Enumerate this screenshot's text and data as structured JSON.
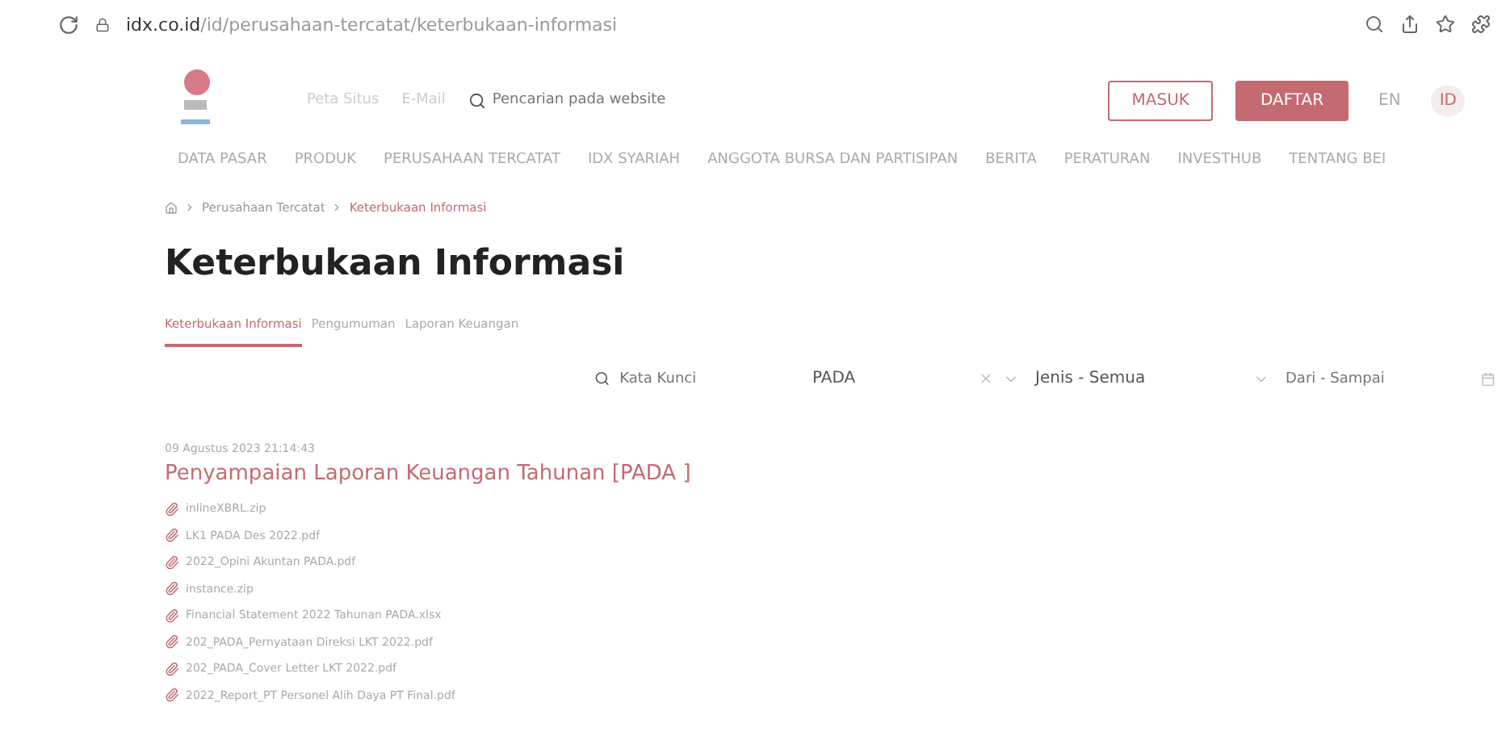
{
  "browser": {
    "url_host": "idx.co.id",
    "url_path": "/id/perusahaan-tercatat/keterbukaan-informasi"
  },
  "header": {
    "links": [
      "Peta Situs",
      "E-Mail"
    ],
    "search": {
      "placeholder": "Pencarian pada website"
    },
    "login": "MASUK",
    "register": "DAFTAR",
    "languages": [
      {
        "label": "EN",
        "selected": false
      },
      {
        "label": "ID",
        "selected": true
      }
    ]
  },
  "nav": [
    "DATA PASAR",
    "PRODUK",
    "PERUSAHAAN TERCATAT",
    "IDX SYARIAH",
    "ANGGOTA BURSA DAN PARTISIPAN",
    "BERITA",
    "PERATURAN",
    "INVESTHUB",
    "TENTANG BEI"
  ],
  "breadcrumb": [
    {
      "label": "Perusahaan Tercatat",
      "current": false
    },
    {
      "label": "Keterbukaan Informasi",
      "current": true
    }
  ],
  "title": "Keterbukaan Informasi",
  "tabs": [
    {
      "label": "Keterbukaan Informasi",
      "selected": true
    },
    {
      "label": "Pengumuman",
      "selected": false
    },
    {
      "label": "Laporan Keuangan",
      "selected": false
    }
  ],
  "filters": {
    "keyword": {
      "placeholder": "Kata Kunci"
    },
    "company": {
      "value": "PADA"
    },
    "type": {
      "value": "Jenis - Semua"
    },
    "date": {
      "placeholder": "Dari - Sampai"
    }
  },
  "announcements": [
    {
      "date": "09 Agustus 2023 21:14:43",
      "title": "Penyampaian Laporan Keuangan Tahunan [PADA ]",
      "attachments": [
        "inlineXBRL.zip",
        "LK1 PADA Des 2022.pdf",
        "2022_Opini Akuntan PADA.pdf",
        "instance.zip",
        "Financial Statement 2022 Tahunan PADA.xlsx",
        "202_PADA_Pernyataan Direksi LKT 2022.pdf",
        "202_PADA_Cover Letter LKT 2022.pdf",
        "2022_Report_PT Personel Alih Daya PT Final.pdf"
      ]
    }
  ]
}
